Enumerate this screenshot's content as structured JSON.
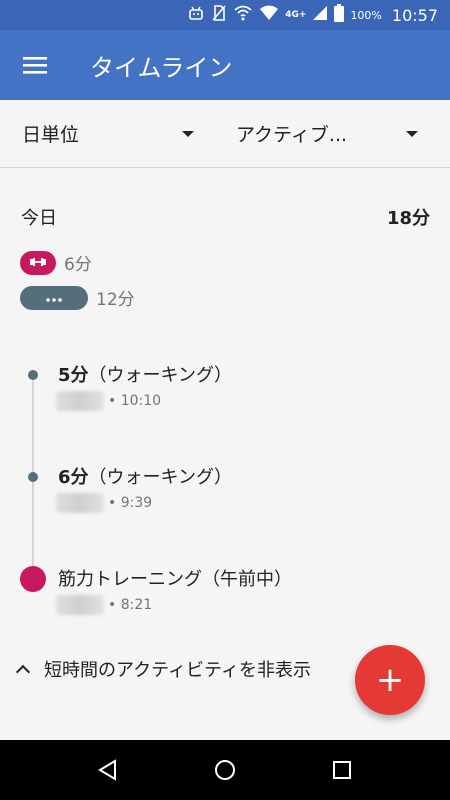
{
  "status_bar": {
    "network": "4G+",
    "battery": "100%",
    "time": "10:57",
    "icons": [
      "android-debug-icon",
      "no-sim-icon",
      "wifi-calling-icon",
      "wifi-icon",
      "signal-icon",
      "battery-icon"
    ]
  },
  "app_bar": {
    "title": "タイムライン",
    "menu_icon": "hamburger-menu-icon",
    "color": "#4472c4"
  },
  "filters": {
    "period": "日単位",
    "type": "アクティブ..."
  },
  "summary": {
    "title": "今日",
    "total": "18分",
    "bars": [
      {
        "icon": "dumbbell-icon",
        "value": "6分",
        "color": "#c8185e"
      },
      {
        "icon": "more-dots-icon",
        "value": "12分",
        "color": "#546e7a"
      }
    ]
  },
  "timeline": {
    "entries": [
      {
        "minutes": "5分",
        "activity": "（ウォーキング）",
        "time": "10:10"
      },
      {
        "minutes": "6分",
        "activity": "（ウォーキング）",
        "time": "9:39"
      },
      {
        "minutes": "",
        "activity": "筋力トレーニング（午前中）",
        "time": "8:21"
      }
    ]
  },
  "toggle": {
    "label": "短時間のアクティビティを非表示"
  },
  "fab": {
    "label": "+",
    "color": "#e53935"
  },
  "nav_bar": {
    "buttons": [
      "back-icon",
      "home-icon",
      "recents-icon"
    ]
  }
}
